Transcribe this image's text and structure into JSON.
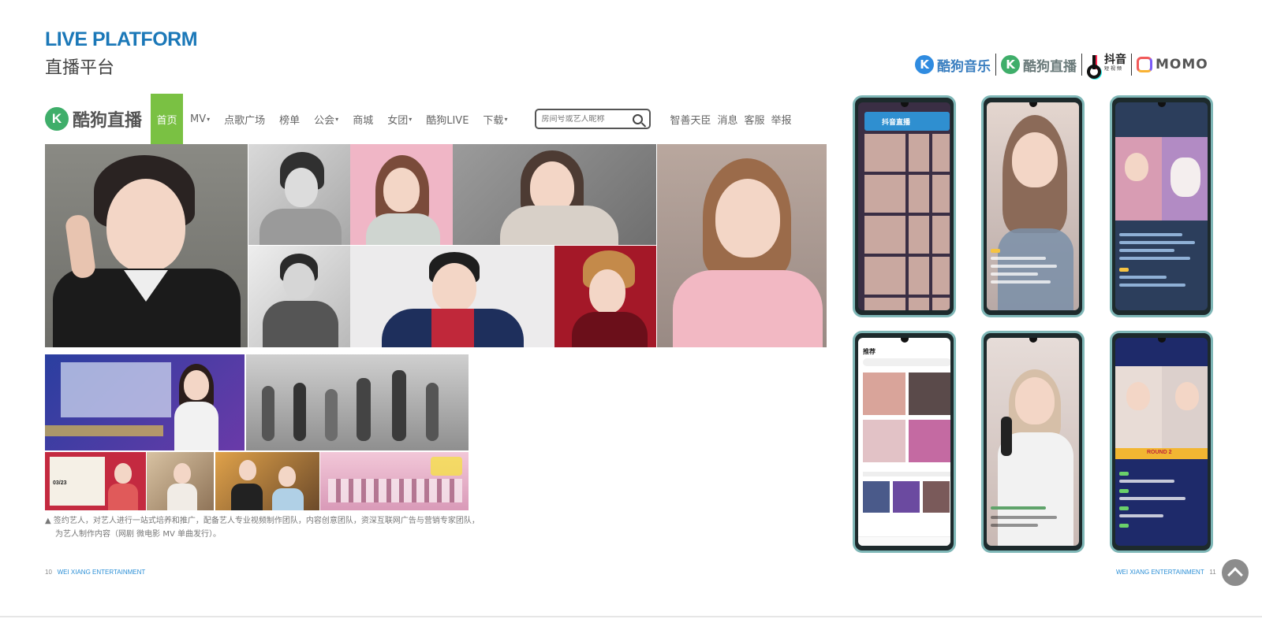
{
  "header": {
    "title_en": "LIVE PLATFORM",
    "title_cn": "直播平台"
  },
  "brands": [
    {
      "name": "酷狗音乐",
      "icon": "kugou-k-icon",
      "color": "#2f8be0"
    },
    {
      "name": "酷狗直播",
      "icon": "kugou-live-k-icon",
      "color": "#3fae6a"
    },
    {
      "name": "抖音",
      "sub": "短视频",
      "icon": "douyin-note-icon"
    },
    {
      "name": "MOMO",
      "icon": "momo-icon"
    }
  ],
  "nav": {
    "logo_text": "酷狗直播",
    "items": [
      {
        "label": "首页",
        "active": true
      },
      {
        "label": "MV",
        "dropdown": true
      },
      {
        "label": "点歌广场"
      },
      {
        "label": "榜单"
      },
      {
        "label": "公会",
        "dropdown": true
      },
      {
        "label": "商城"
      },
      {
        "label": "女团",
        "dropdown": true
      },
      {
        "label": "酷狗LIVE"
      },
      {
        "label": "下载",
        "dropdown": true
      }
    ],
    "search_placeholder": "房间号或艺人昵称",
    "right_links": [
      "智善天臣",
      "消息",
      "客服",
      "举报"
    ],
    "active_color": "#7ac143"
  },
  "caption": {
    "line1": "▲ 签约艺人，对艺人进行一站式培养和推广，配备艺人专业视频制作团队，内容创意团队，资深互联网广告与营销专家团队，",
    "line2": "为艺人制作内容（网剧 微电影 MV 单曲发行）。"
  },
  "footer": {
    "left_page": "10",
    "left_text": "WEI XIANG ENTERTAINMENT",
    "right_text": "WEI XIANG ENTERTAINMENT",
    "right_page": "11"
  },
  "photo_texts": {
    "event_banner": "03/23"
  },
  "phones": [
    {
      "label": "抖音直播"
    },
    {
      "label": ""
    },
    {
      "label": ""
    },
    {
      "label": "推荐"
    },
    {
      "label": ""
    },
    {
      "label": "ROUND 2"
    }
  ]
}
